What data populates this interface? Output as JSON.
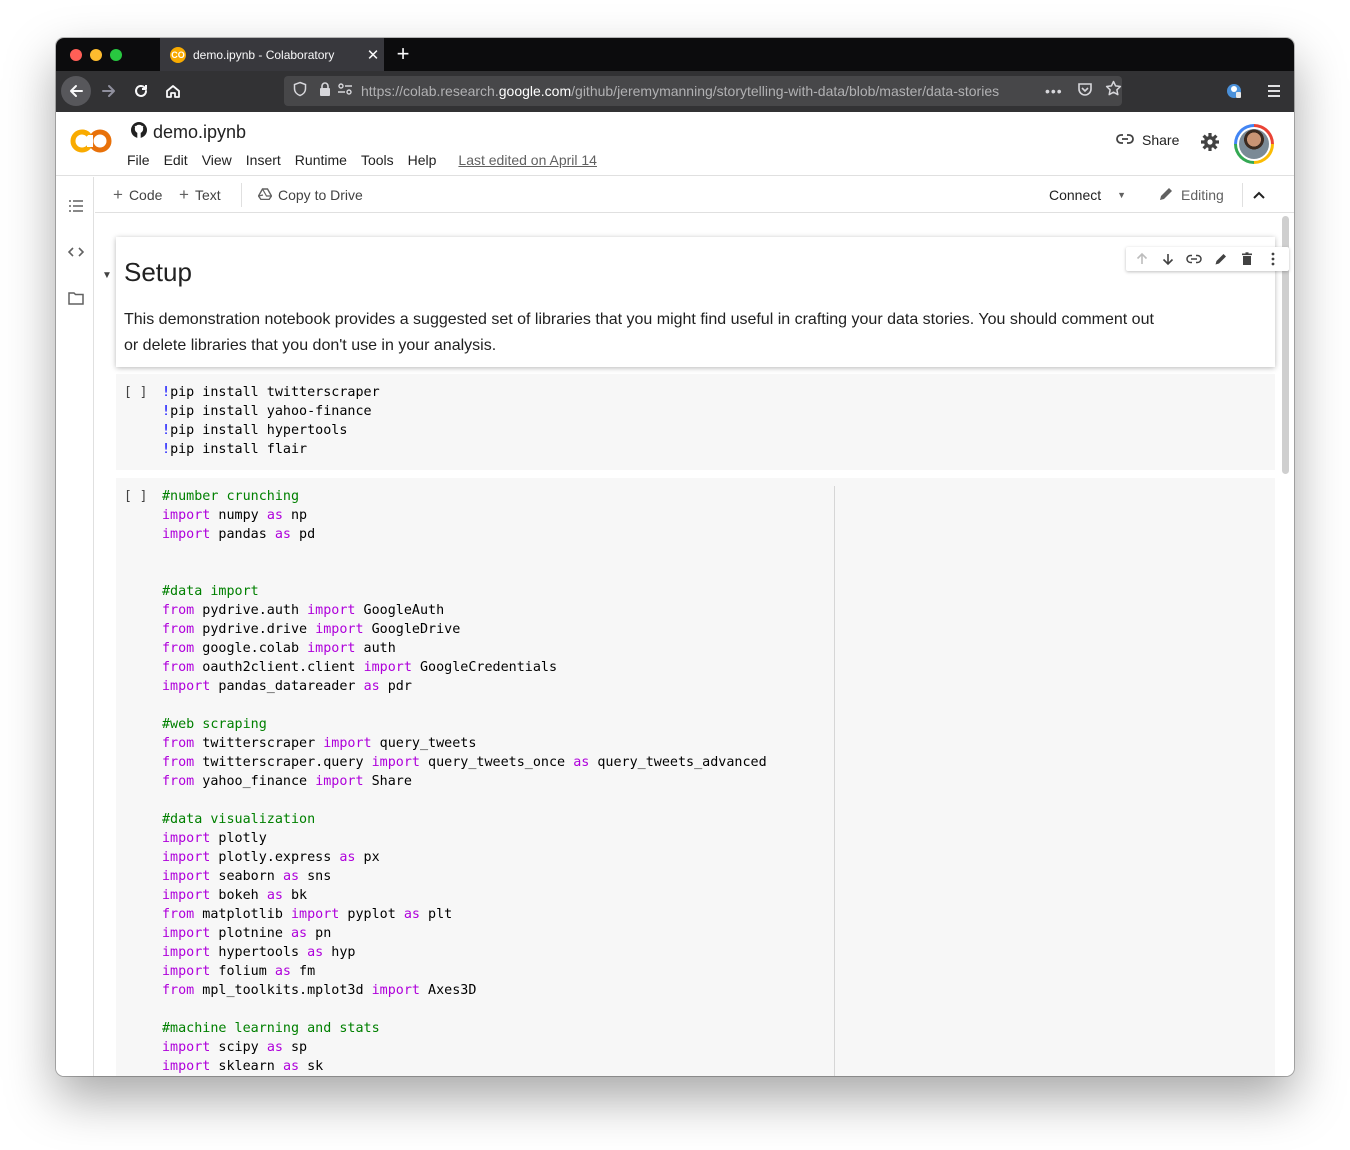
{
  "browser": {
    "tab_title": "demo.ipynb - Colaboratory",
    "tab_favicon_text": "CO",
    "tab_close": "✕",
    "new_tab": "+",
    "url_prefix": "https://colab.research.",
    "url_host": "google.com",
    "url_path": "/github/jeremymanning/storytelling-with-data/blob/master/data-stories",
    "url_more": "•••"
  },
  "colab": {
    "notebook_title": "demo.ipynb",
    "menu": [
      "File",
      "Edit",
      "View",
      "Insert",
      "Runtime",
      "Tools",
      "Help"
    ],
    "last_edited": "Last edited on April 14",
    "share_label": "Share"
  },
  "toolbar": {
    "add_code": "Code",
    "add_text": "Text",
    "copy_to_drive": "Copy to Drive",
    "connect": "Connect",
    "editing": "Editing"
  },
  "cells": {
    "text_cell": {
      "heading": "Setup",
      "paragraph": "This demonstration notebook provides a suggested set of libraries that you might find useful in crafting your data stories. You should comment out or delete libraries that you don't use in your analysis."
    },
    "run_indicator": "[ ]",
    "cell1": [
      [
        [
          "bang",
          "!"
        ],
        [
          "t",
          "pip install twitterscraper"
        ]
      ],
      [
        [
          "bang",
          "!"
        ],
        [
          "t",
          "pip install yahoo-finance"
        ]
      ],
      [
        [
          "bang",
          "!"
        ],
        [
          "t",
          "pip install hypertools"
        ]
      ],
      [
        [
          "bang",
          "!"
        ],
        [
          "t",
          "pip install flair"
        ]
      ]
    ],
    "cell2": [
      [
        [
          "cm",
          "#number crunching"
        ]
      ],
      [
        [
          "kw",
          "import"
        ],
        [
          "t",
          " numpy "
        ],
        [
          "kw",
          "as"
        ],
        [
          "t",
          " np"
        ]
      ],
      [
        [
          "kw",
          "import"
        ],
        [
          "t",
          " pandas "
        ],
        [
          "kw",
          "as"
        ],
        [
          "t",
          " pd"
        ]
      ],
      [],
      [],
      [
        [
          "cm",
          "#data import"
        ]
      ],
      [
        [
          "kw",
          "from"
        ],
        [
          "t",
          " pydrive.auth "
        ],
        [
          "kw",
          "import"
        ],
        [
          "t",
          " GoogleAuth"
        ]
      ],
      [
        [
          "kw",
          "from"
        ],
        [
          "t",
          " pydrive.drive "
        ],
        [
          "kw",
          "import"
        ],
        [
          "t",
          " GoogleDrive"
        ]
      ],
      [
        [
          "kw",
          "from"
        ],
        [
          "t",
          " google.colab "
        ],
        [
          "kw",
          "import"
        ],
        [
          "t",
          " auth"
        ]
      ],
      [
        [
          "kw",
          "from"
        ],
        [
          "t",
          " oauth2client.client "
        ],
        [
          "kw",
          "import"
        ],
        [
          "t",
          " GoogleCredentials"
        ]
      ],
      [
        [
          "kw",
          "import"
        ],
        [
          "t",
          " pandas_datareader "
        ],
        [
          "kw",
          "as"
        ],
        [
          "t",
          " pdr"
        ]
      ],
      [],
      [
        [
          "cm",
          "#web scraping"
        ]
      ],
      [
        [
          "kw",
          "from"
        ],
        [
          "t",
          " twitterscraper "
        ],
        [
          "kw",
          "import"
        ],
        [
          "t",
          " query_tweets"
        ]
      ],
      [
        [
          "kw",
          "from"
        ],
        [
          "t",
          " twitterscraper.query "
        ],
        [
          "kw",
          "import"
        ],
        [
          "t",
          " query_tweets_once "
        ],
        [
          "kw",
          "as"
        ],
        [
          "t",
          " query_tweets_advanced"
        ]
      ],
      [
        [
          "kw",
          "from"
        ],
        [
          "t",
          " yahoo_finance "
        ],
        [
          "kw",
          "import"
        ],
        [
          "t",
          " Share"
        ]
      ],
      [],
      [
        [
          "cm",
          "#data visualization"
        ]
      ],
      [
        [
          "kw",
          "import"
        ],
        [
          "t",
          " plotly"
        ]
      ],
      [
        [
          "kw",
          "import"
        ],
        [
          "t",
          " plotly.express "
        ],
        [
          "kw",
          "as"
        ],
        [
          "t",
          " px"
        ]
      ],
      [
        [
          "kw",
          "import"
        ],
        [
          "t",
          " seaborn "
        ],
        [
          "kw",
          "as"
        ],
        [
          "t",
          " sns"
        ]
      ],
      [
        [
          "kw",
          "import"
        ],
        [
          "t",
          " bokeh "
        ],
        [
          "kw",
          "as"
        ],
        [
          "t",
          " bk"
        ]
      ],
      [
        [
          "kw",
          "from"
        ],
        [
          "t",
          " matplotlib "
        ],
        [
          "kw",
          "import"
        ],
        [
          "t",
          " pyplot "
        ],
        [
          "kw",
          "as"
        ],
        [
          "t",
          " plt"
        ]
      ],
      [
        [
          "kw",
          "import"
        ],
        [
          "t",
          " plotnine "
        ],
        [
          "kw",
          "as"
        ],
        [
          "t",
          " pn"
        ]
      ],
      [
        [
          "kw",
          "import"
        ],
        [
          "t",
          " hypertools "
        ],
        [
          "kw",
          "as"
        ],
        [
          "t",
          " hyp"
        ]
      ],
      [
        [
          "kw",
          "import"
        ],
        [
          "t",
          " folium "
        ],
        [
          "kw",
          "as"
        ],
        [
          "t",
          " fm"
        ]
      ],
      [
        [
          "kw",
          "from"
        ],
        [
          "t",
          " mpl_toolkits.mplot3d "
        ],
        [
          "kw",
          "import"
        ],
        [
          "t",
          " Axes3D"
        ]
      ],
      [],
      [
        [
          "cm",
          "#machine learning and stats"
        ]
      ],
      [
        [
          "kw",
          "import"
        ],
        [
          "t",
          " scipy "
        ],
        [
          "kw",
          "as"
        ],
        [
          "t",
          " sp"
        ]
      ],
      [
        [
          "kw",
          "import"
        ],
        [
          "t",
          " sklearn "
        ],
        [
          "kw",
          "as"
        ],
        [
          "t",
          " sk"
        ]
      ]
    ]
  },
  "colors": {
    "keyword": "#af00db",
    "comment": "#008000",
    "shell_bang": "#0000ff",
    "colab_orange": "#f9ab00"
  },
  "icons": {
    "browser": [
      "back-arrow-icon",
      "forward-arrow-icon",
      "reload-icon",
      "home-icon",
      "shield-icon",
      "lock-icon",
      "permissions-icon",
      "pocket-icon",
      "bookmark-star-icon",
      "extension-icon",
      "hamburger-menu-icon"
    ],
    "colab": [
      "colab-logo-icon",
      "github-icon",
      "link-icon",
      "gear-icon",
      "avatar"
    ],
    "sidebar": [
      "table-of-contents-icon",
      "code-snippets-icon",
      "files-folder-icon"
    ],
    "cell_toolbar": [
      "move-up-icon",
      "move-down-icon",
      "link-icon",
      "edit-icon",
      "delete-icon",
      "more-vert-icon"
    ]
  }
}
